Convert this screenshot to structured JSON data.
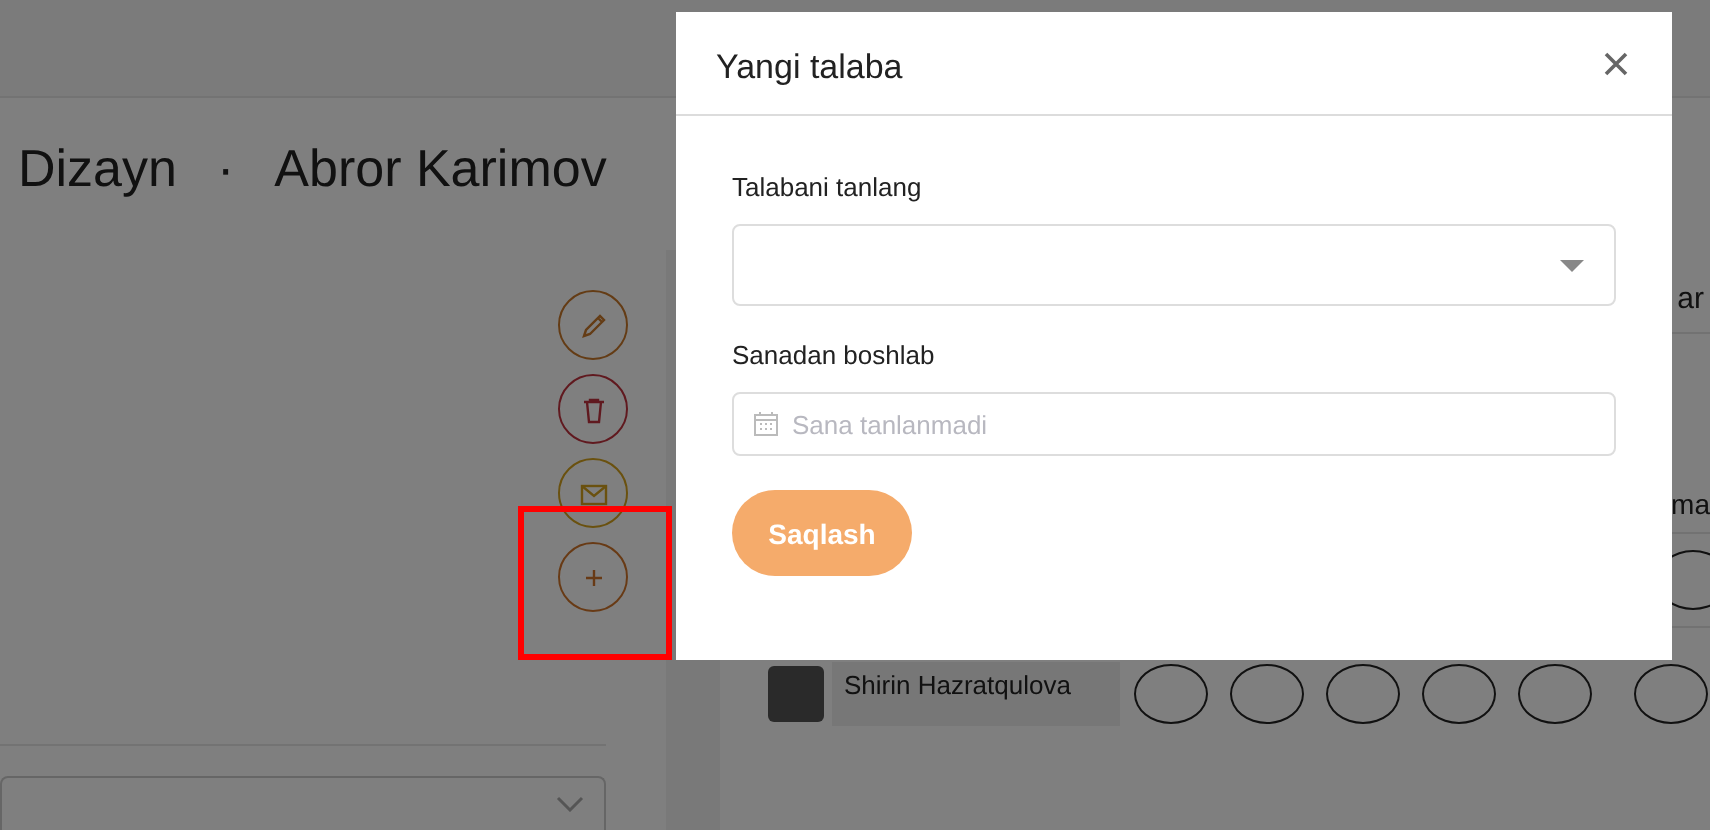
{
  "header": {
    "group": "Dizayn",
    "separator": "·",
    "teacher": "Abror Karimov"
  },
  "actions": [
    {
      "kind": "edit"
    },
    {
      "kind": "delete"
    },
    {
      "kind": "message"
    },
    {
      "kind": "add",
      "highlighted": true
    }
  ],
  "right_panel": {
    "column_label": "ar",
    "row_label": "ma",
    "students": [
      {
        "name": "Shirin Hazratqulova"
      }
    ]
  },
  "modal": {
    "title": "Yangi talaba",
    "fields": [
      {
        "kind": "select",
        "label": "Talabani tanlang"
      },
      {
        "kind": "date",
        "label": "Sanadan boshlab",
        "placeholder": "Sana tanlanmadi"
      }
    ],
    "submit": "Saqlash"
  }
}
